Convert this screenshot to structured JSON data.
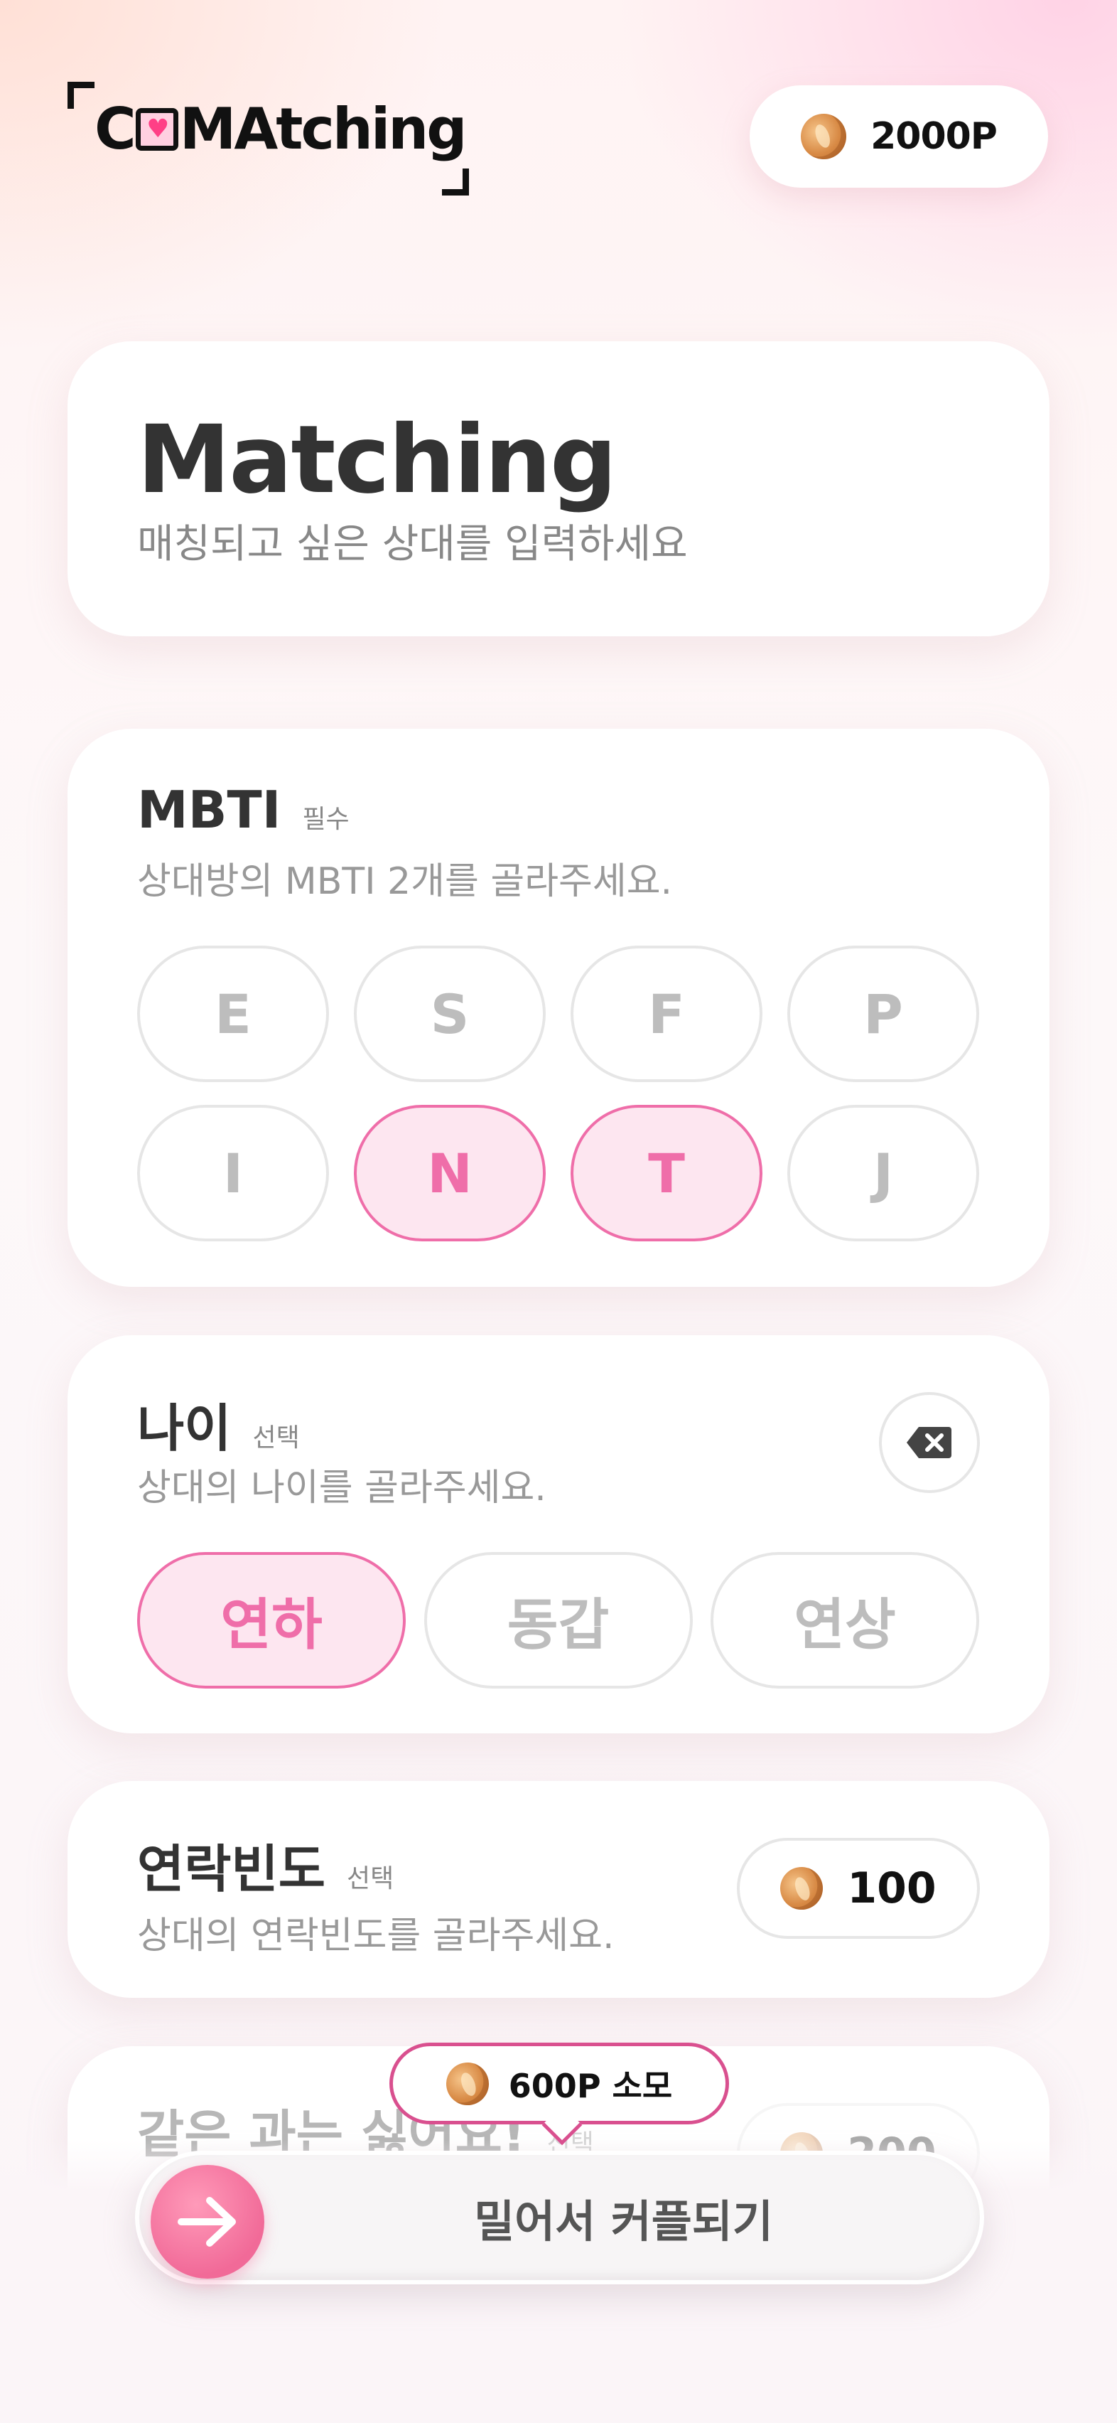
{
  "header": {
    "logo_text_start": "C",
    "logo_heart": "♥",
    "logo_text_end": "MAtching",
    "points": "2000P"
  },
  "title_card": {
    "title": "Matching",
    "subtitle": "매칭되고 싶은 상대를 입력하세요"
  },
  "mbti": {
    "title": "MBTI",
    "tag": "필수",
    "subtitle": "상대방의 MBTI 2개를 골라주세요.",
    "options": [
      {
        "label": "E",
        "selected": false
      },
      {
        "label": "S",
        "selected": false
      },
      {
        "label": "F",
        "selected": false
      },
      {
        "label": "P",
        "selected": false
      },
      {
        "label": "I",
        "selected": false
      },
      {
        "label": "N",
        "selected": true
      },
      {
        "label": "T",
        "selected": true
      },
      {
        "label": "J",
        "selected": false
      }
    ]
  },
  "age": {
    "title": "나이",
    "tag": "선택",
    "subtitle": "상대의 나이를 골라주세요.",
    "options": [
      {
        "label": "연하",
        "selected": true
      },
      {
        "label": "동갑",
        "selected": false
      },
      {
        "label": "연상",
        "selected": false
      }
    ]
  },
  "frequency": {
    "title": "연락빈도",
    "tag": "선택",
    "subtitle": "상대의 연락빈도를 골라주세요.",
    "cost": "100"
  },
  "next_section": {
    "title": "같은 과는 싫어요!",
    "tag": "선택",
    "cost": "200"
  },
  "tooltip": {
    "text": "600P 소모"
  },
  "cta": {
    "label": "밀어서 커플되기"
  },
  "colors": {
    "accent": "#ef6ea9",
    "accent_bg": "#fde6f0",
    "tooltip_border": "#d9508f"
  }
}
